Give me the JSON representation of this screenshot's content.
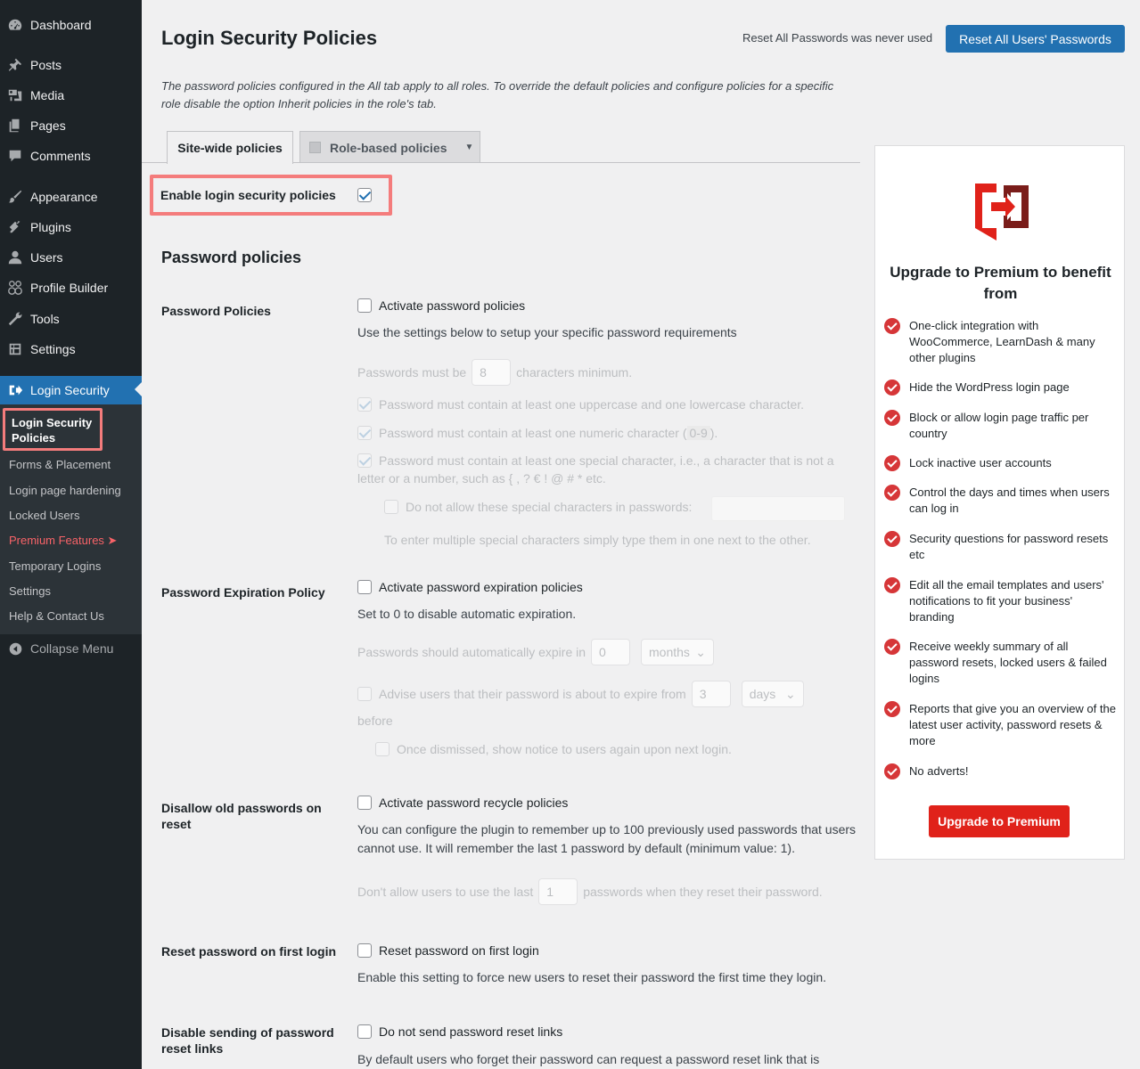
{
  "sidebar": {
    "items": [
      {
        "label": "Dashboard",
        "icon": "dashboard-icon"
      },
      {
        "label": "Posts",
        "icon": "pin-icon"
      },
      {
        "label": "Media",
        "icon": "media-icon"
      },
      {
        "label": "Pages",
        "icon": "pages-icon"
      },
      {
        "label": "Comments",
        "icon": "comment-icon"
      },
      {
        "label": "Appearance",
        "icon": "brush-icon"
      },
      {
        "label": "Plugins",
        "icon": "plug-icon"
      },
      {
        "label": "Users",
        "icon": "user-icon"
      },
      {
        "label": "Profile Builder",
        "icon": "profile-builder-icon"
      },
      {
        "label": "Tools",
        "icon": "wrench-icon"
      },
      {
        "label": "Settings",
        "icon": "settings-icon"
      },
      {
        "label": "Login Security",
        "icon": "login-security-icon"
      }
    ],
    "submenu": {
      "current": "Login Security Policies",
      "items": [
        "Forms & Placement",
        "Login page hardening",
        "Locked Users",
        "Premium Features ➤",
        "Temporary Logins",
        "Settings",
        "Help & Contact Us"
      ]
    },
    "collapse_label": "Collapse Menu"
  },
  "header": {
    "title": "Login Security Policies",
    "reset_note": "Reset All Passwords was never used",
    "reset_button": "Reset All Users' Passwords"
  },
  "intro": "The password policies configured in the All tab apply to all roles. To override the default policies and configure policies for a specific role disable the option Inherit policies in the role's tab.",
  "tabs": {
    "site_wide": "Site-wide policies",
    "role_based": "Role-based policies"
  },
  "enable_label": "Enable login security policies",
  "section_title": "Password policies",
  "password_policies": {
    "label": "Password Policies",
    "activate": "Activate password policies",
    "desc": "Use the settings below to setup your specific password requirements",
    "min_prefix": "Passwords must be",
    "min_value": "8",
    "min_suffix": "characters minimum.",
    "uppercase": "Password must contain at least one uppercase and one lowercase character.",
    "numeric": "Password must contain at least one numeric character (",
    "numeric_range": "0-9",
    "numeric_close": ").",
    "special_line1": "Password must contain at least one special character, i.e., a character that is not a",
    "special_line2": "letter or a number, such as { , ? € ! @ # * etc.",
    "disallow_special": "Do not allow these special characters in passwords:",
    "special_hint": "To enter multiple special characters simply type them in one next to the other."
  },
  "expiration": {
    "label": "Password Expiration Policy",
    "activate": "Activate password expiration policies",
    "desc": "Set to 0 to disable automatic expiration.",
    "expire_prefix": "Passwords should automatically expire in",
    "expire_value": "0",
    "expire_unit": "months",
    "advise": "Advise users that their password is about to expire from",
    "advise_value": "3",
    "advise_unit": "days",
    "before": "before",
    "dismissed": "Once dismissed, show notice to users again upon next login."
  },
  "recycle": {
    "label": "Disallow old passwords on reset",
    "activate": "Activate password recycle policies",
    "desc": "You can configure the plugin to remember up to 100 previously used passwords that users cannot use. It will remember the last 1 password by default (minimum value: 1).",
    "last_prefix": "Don't allow users to use the last",
    "last_value": "1",
    "last_suffix": "passwords when they reset their password."
  },
  "first_login": {
    "label": "Reset password on first login",
    "activate": "Reset password on first login",
    "desc": "Enable this setting to force new users to reset their password the first time they login."
  },
  "reset_links": {
    "label": "Disable sending of password reset links",
    "activate": "Do not send password reset links",
    "desc": "By default users who forget their password can request a password reset link that is"
  },
  "promo": {
    "title": "Upgrade to Premium to benefit from",
    "features": [
      "One-click integration with WooCommerce, LearnDash & many other plugins",
      "Hide the WordPress login page",
      "Block or allow login page traffic per country",
      "Lock inactive user accounts",
      "Control the days and times when users can log in",
      "Security questions for password resets etc",
      "Edit all the email templates and users' notifications to fit your business' branding",
      "Receive weekly summary of all password resets, locked users & failed logins",
      "Reports that give you an overview of the latest user activity, password resets & more",
      "No adverts!"
    ],
    "button": "Upgrade to Premium"
  },
  "colors": {
    "sidebar": "#1d2327",
    "accent": "#2271b1",
    "highlight": "#f47c7c",
    "promo_red": "#e0221a"
  }
}
